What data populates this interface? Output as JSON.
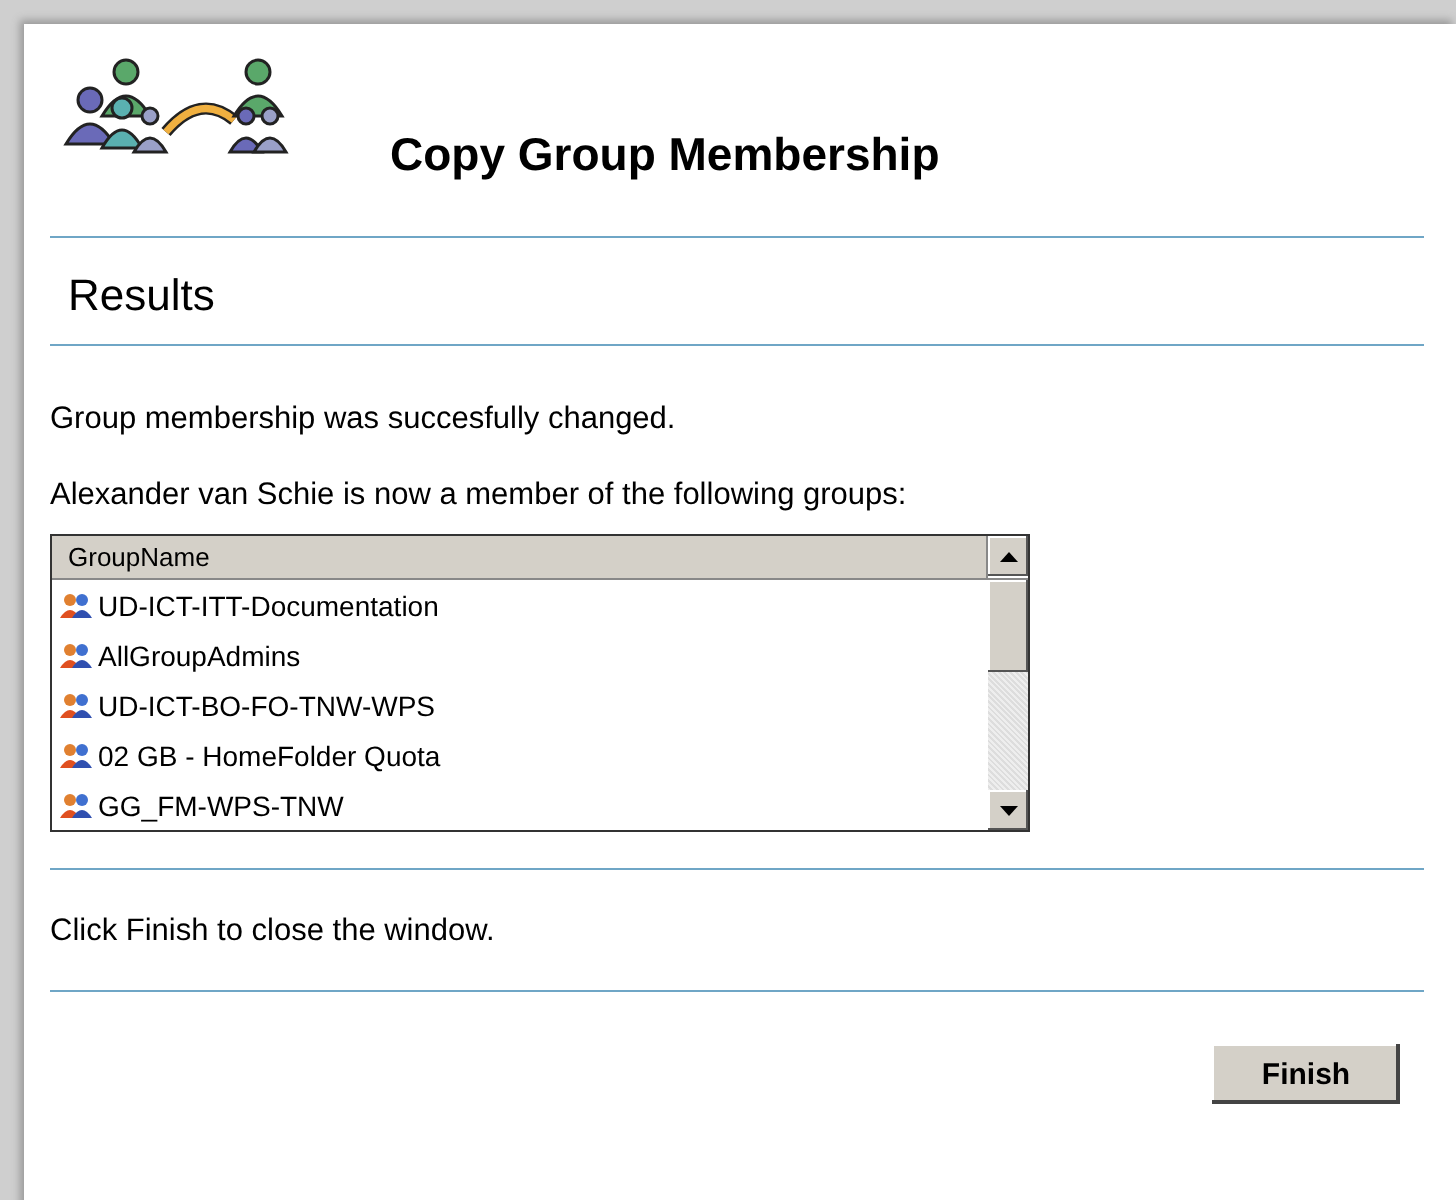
{
  "header": {
    "title": "Copy Group Membership"
  },
  "section_title": "Results",
  "messages": [
    "Group membership was succesfully changed.",
    "Alexander van Schie is now a member of the following groups:"
  ],
  "list": {
    "column": "GroupName",
    "rows": [
      {
        "name": "UD-ICT-ITT-Documentation"
      },
      {
        "name": "AllGroupAdmins"
      },
      {
        "name": "UD-ICT-BO-FO-TNW-WPS"
      },
      {
        "name": "02 GB - HomeFolder Quota"
      },
      {
        "name": "GG_FM-WPS-TNW"
      }
    ]
  },
  "footer_text": "Click Finish to close the window.",
  "buttons": [
    "Finish"
  ]
}
